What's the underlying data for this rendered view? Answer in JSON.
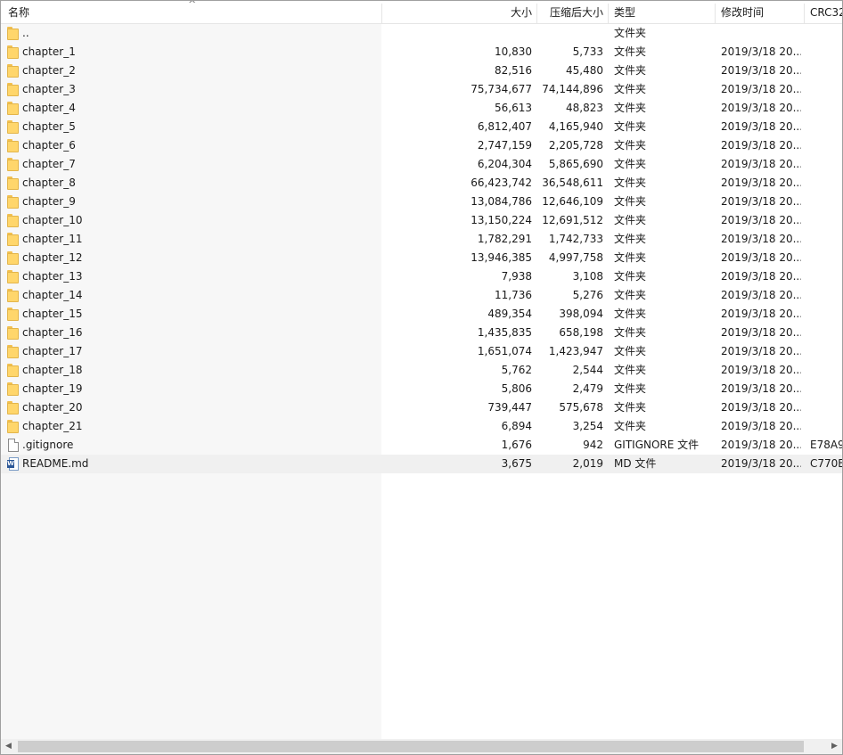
{
  "columns": {
    "name": "名称",
    "size": "大小",
    "packed": "压缩后大小",
    "type": "类型",
    "modified": "修改时间",
    "crc": "CRC32"
  },
  "sort_indicator": "^",
  "rows": [
    {
      "icon": "folder-icon",
      "name": "..",
      "size": "",
      "packed": "",
      "type": "文件夹",
      "modified": "",
      "crc": ""
    },
    {
      "icon": "folder-icon",
      "name": "chapter_1",
      "size": "10,830",
      "packed": "5,733",
      "type": "文件夹",
      "modified": "2019/3/18 20...",
      "crc": ""
    },
    {
      "icon": "folder-icon",
      "name": "chapter_2",
      "size": "82,516",
      "packed": "45,480",
      "type": "文件夹",
      "modified": "2019/3/18 20...",
      "crc": ""
    },
    {
      "icon": "folder-icon",
      "name": "chapter_3",
      "size": "75,734,677",
      "packed": "74,144,896",
      "type": "文件夹",
      "modified": "2019/3/18 20...",
      "crc": ""
    },
    {
      "icon": "folder-icon",
      "name": "chapter_4",
      "size": "56,613",
      "packed": "48,823",
      "type": "文件夹",
      "modified": "2019/3/18 20...",
      "crc": ""
    },
    {
      "icon": "folder-icon",
      "name": "chapter_5",
      "size": "6,812,407",
      "packed": "4,165,940",
      "type": "文件夹",
      "modified": "2019/3/18 20...",
      "crc": ""
    },
    {
      "icon": "folder-icon",
      "name": "chapter_6",
      "size": "2,747,159",
      "packed": "2,205,728",
      "type": "文件夹",
      "modified": "2019/3/18 20...",
      "crc": ""
    },
    {
      "icon": "folder-icon",
      "name": "chapter_7",
      "size": "6,204,304",
      "packed": "5,865,690",
      "type": "文件夹",
      "modified": "2019/3/18 20...",
      "crc": ""
    },
    {
      "icon": "folder-icon",
      "name": "chapter_8",
      "size": "66,423,742",
      "packed": "36,548,611",
      "type": "文件夹",
      "modified": "2019/3/18 20...",
      "crc": ""
    },
    {
      "icon": "folder-icon",
      "name": "chapter_9",
      "size": "13,084,786",
      "packed": "12,646,109",
      "type": "文件夹",
      "modified": "2019/3/18 20...",
      "crc": ""
    },
    {
      "icon": "folder-icon",
      "name": "chapter_10",
      "size": "13,150,224",
      "packed": "12,691,512",
      "type": "文件夹",
      "modified": "2019/3/18 20...",
      "crc": ""
    },
    {
      "icon": "folder-icon",
      "name": "chapter_11",
      "size": "1,782,291",
      "packed": "1,742,733",
      "type": "文件夹",
      "modified": "2019/3/18 20...",
      "crc": ""
    },
    {
      "icon": "folder-icon",
      "name": "chapter_12",
      "size": "13,946,385",
      "packed": "4,997,758",
      "type": "文件夹",
      "modified": "2019/3/18 20...",
      "crc": ""
    },
    {
      "icon": "folder-icon",
      "name": "chapter_13",
      "size": "7,938",
      "packed": "3,108",
      "type": "文件夹",
      "modified": "2019/3/18 20...",
      "crc": ""
    },
    {
      "icon": "folder-icon",
      "name": "chapter_14",
      "size": "11,736",
      "packed": "5,276",
      "type": "文件夹",
      "modified": "2019/3/18 20...",
      "crc": ""
    },
    {
      "icon": "folder-icon",
      "name": "chapter_15",
      "size": "489,354",
      "packed": "398,094",
      "type": "文件夹",
      "modified": "2019/3/18 20...",
      "crc": ""
    },
    {
      "icon": "folder-icon",
      "name": "chapter_16",
      "size": "1,435,835",
      "packed": "658,198",
      "type": "文件夹",
      "modified": "2019/3/18 20...",
      "crc": ""
    },
    {
      "icon": "folder-icon",
      "name": "chapter_17",
      "size": "1,651,074",
      "packed": "1,423,947",
      "type": "文件夹",
      "modified": "2019/3/18 20...",
      "crc": ""
    },
    {
      "icon": "folder-icon",
      "name": "chapter_18",
      "size": "5,762",
      "packed": "2,544",
      "type": "文件夹",
      "modified": "2019/3/18 20...",
      "crc": ""
    },
    {
      "icon": "folder-icon",
      "name": "chapter_19",
      "size": "5,806",
      "packed": "2,479",
      "type": "文件夹",
      "modified": "2019/3/18 20...",
      "crc": ""
    },
    {
      "icon": "folder-icon",
      "name": "chapter_20",
      "size": "739,447",
      "packed": "575,678",
      "type": "文件夹",
      "modified": "2019/3/18 20...",
      "crc": ""
    },
    {
      "icon": "folder-icon",
      "name": "chapter_21",
      "size": "6,894",
      "packed": "3,254",
      "type": "文件夹",
      "modified": "2019/3/18 20...",
      "crc": ""
    },
    {
      "icon": "file-icon",
      "name": ".gitignore",
      "size": "1,676",
      "packed": "942",
      "type": "GITIGNORE 文件",
      "modified": "2019/3/18 20...",
      "crc": "E78A9"
    },
    {
      "icon": "doc-icon",
      "name": "README.md",
      "size": "3,675",
      "packed": "2,019",
      "type": "MD 文件",
      "modified": "2019/3/18 20...",
      "crc": "C770E",
      "selected": true
    }
  ],
  "scrollbar": {
    "left_arrow": "◀",
    "right_arrow": "▶"
  }
}
